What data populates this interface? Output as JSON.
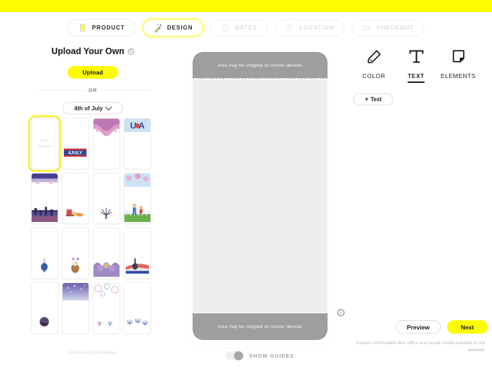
{
  "brand": {
    "accent_yellow": "#FFFC00",
    "selection_yellow": "#F7F24B"
  },
  "stepnav": {
    "steps": [
      {
        "label": "PRODUCT",
        "icon": "phone-icon",
        "state": "complete"
      },
      {
        "label": "DESIGN",
        "icon": "magic-wand-icon",
        "state": "active"
      },
      {
        "label": "DATES",
        "icon": "calendar-icon",
        "state": "disabled"
      },
      {
        "label": "LOCATION",
        "icon": "map-pin-icon",
        "state": "disabled"
      },
      {
        "label": "CHECKOUT",
        "icon": "credit-card-icon",
        "state": "disabled"
      }
    ]
  },
  "left_panel": {
    "title": "Upload Your Own",
    "title_info_icon": "info-icon",
    "upload_button": "Upload",
    "divider_text": "OR",
    "category_select": {
      "value": "4th of July",
      "chevron": "chevron-down-icon"
    },
    "submission_guidelines": "Submission Guidelines",
    "templates": [
      {
        "name": "Blank Template",
        "label": "Blank\nTemplate",
        "selected": true,
        "art": "blank"
      },
      {
        "name": "4th of July banner",
        "selected": false,
        "art": "fourjuly-banner"
      },
      {
        "name": "Pink fireworks arch",
        "selected": false,
        "art": "pink-arch"
      },
      {
        "name": "USA letters",
        "selected": false,
        "art": "usa-letters"
      },
      {
        "name": "City skyline fireworks",
        "selected": false,
        "art": "skyline"
      },
      {
        "name": "Picnic basket",
        "selected": false,
        "art": "picnic"
      },
      {
        "name": "Sparkler burst",
        "selected": false,
        "art": "sparkler"
      },
      {
        "name": "Kids with flag",
        "selected": false,
        "art": "kids-flag"
      },
      {
        "name": "Blue balloon",
        "selected": false,
        "art": "balloon"
      },
      {
        "name": "Eagle mascot",
        "selected": false,
        "art": "eagle"
      },
      {
        "name": "Firework bloom",
        "selected": false,
        "art": "bloom"
      },
      {
        "name": "Guitar and flag",
        "selected": false,
        "art": "guitar-flag"
      },
      {
        "name": "Night moon",
        "selected": false,
        "art": "moon"
      },
      {
        "name": "Purple sparkle sky",
        "selected": false,
        "art": "purple-sky"
      },
      {
        "name": "Red white blue confetti",
        "selected": false,
        "art": "confetti"
      },
      {
        "name": "Blue star burst",
        "selected": false,
        "art": "star-burst"
      }
    ]
  },
  "canvas": {
    "top_crop_notice": "Area may be cropped on shorter devices",
    "bottom_crop_notice": "Area may be cropped on shorter devices",
    "info_icon": "info-icon",
    "guides_toggle": {
      "label": "SHOW GUIDES",
      "state": "on"
    }
  },
  "right_panel": {
    "tools": [
      {
        "label": "COLOR",
        "icon": "pen-icon",
        "active": false
      },
      {
        "label": "TEXT",
        "icon": "text-t-icon",
        "active": true
      },
      {
        "label": "ELEMENTS",
        "icon": "sticker-icon",
        "active": false
      }
    ],
    "add_text_button": {
      "plus": "+",
      "label": "Text"
    },
    "preview_button": "Preview",
    "next_button": "Next",
    "disclaimer": "Contact information like URLs and social media handles is not allowed."
  }
}
